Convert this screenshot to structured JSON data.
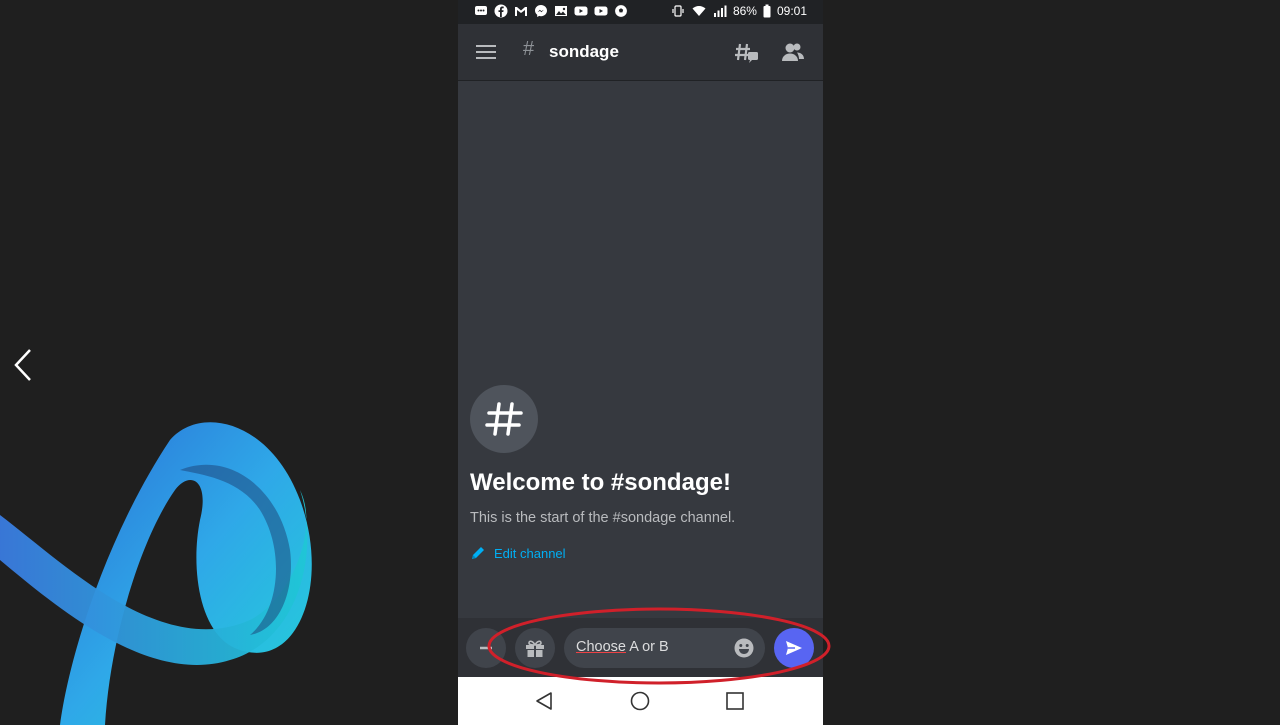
{
  "status_bar": {
    "battery": "86%",
    "time": "09:01",
    "notification_icons": [
      "chat-icon",
      "facebook-icon",
      "gmail-icon",
      "messenger-icon",
      "gallery-icon",
      "youtube-icon",
      "youtube-icon",
      "soccer-ball-icon"
    ]
  },
  "header": {
    "channel_prefix": "#",
    "channel_name": "sondage"
  },
  "welcome": {
    "title": "Welcome to #sondage!",
    "subtitle": "This is the start of the #sondage channel.",
    "edit_label": "Edit channel"
  },
  "composer": {
    "message_word1": "Choose",
    "message_rest": " A or B"
  },
  "colors": {
    "accent": "#5865f2",
    "link": "#00aff4",
    "highlight": "#d0202a"
  }
}
